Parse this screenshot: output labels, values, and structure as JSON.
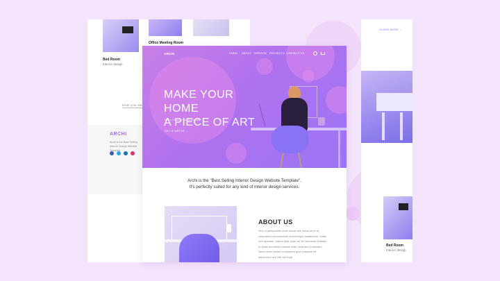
{
  "left_card": {
    "top_caption": "Office Meeting Room",
    "item_title": "Bed Room",
    "item_subtitle": "Interior design",
    "email_placeholder": "Enter your email",
    "brand": "ARCHI",
    "brand_text": "Archi is the Best Selling Interior Design Website Template"
  },
  "nav": {
    "logo": "ARCHI",
    "items": [
      "HOME",
      "ABOUT",
      "SERVICE",
      "PROJECTS",
      "CONTACT US"
    ]
  },
  "hero": {
    "title_line1": "MAKE YOUR HOME",
    "title_line2": "A PIECE OF ART",
    "subtitle": "Make it simple but significant",
    "cta": "GET STARTED →"
  },
  "intro": {
    "line1": "Archi is the \"Best Selling Interior Design Website Template\".",
    "line2": "It's perfectly suited for any kind of interior design services."
  },
  "about": {
    "title": "ABOUT US",
    "body": "Sed ut perspiciatis unde omnis iste natus error sit voluptatem accusantium doloremque laudantium, totam rem aperiam, eaque ipsa quae ab illo inventore veritatis et quasi architecto beatae vitae dicta sunt explicabo. Nemo enim ipsam voluptatem quia voluptas sit aspernatur aut odit aut fugit."
  },
  "right_card": {
    "link": "LEARN MORE →",
    "item_title": "Bed Room",
    "item_subtitle": "Interior design"
  },
  "colors": {
    "page_bg": "#f3e3fb",
    "hero_start": "#c97fe6",
    "hero_end": "#9b74f5",
    "accent": "#9c6cf2"
  }
}
